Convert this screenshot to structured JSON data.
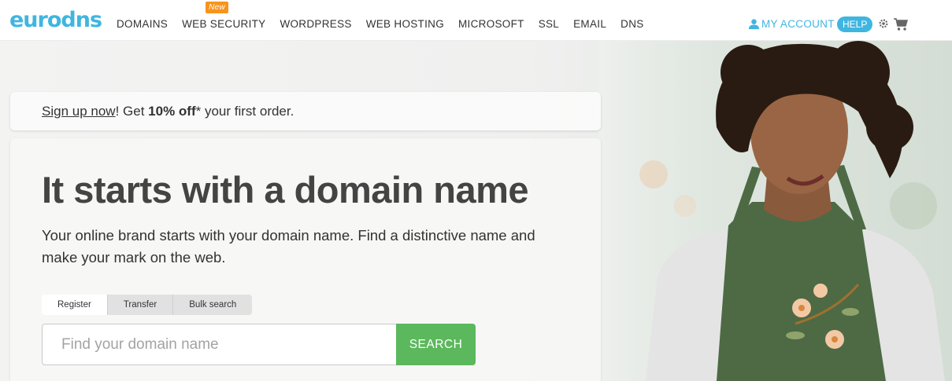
{
  "header": {
    "logo": "eurodns",
    "nav": [
      {
        "label": "DOMAINS"
      },
      {
        "label": "WEB SECURITY",
        "badge": "New"
      },
      {
        "label": "WORDPRESS"
      },
      {
        "label": "WEB HOSTING"
      },
      {
        "label": "MICROSOFT"
      },
      {
        "label": "SSL"
      },
      {
        "label": "EMAIL"
      },
      {
        "label": "DNS"
      }
    ],
    "account_label": "MY ACCOUNT",
    "help_label": "HELP",
    "icons": [
      "user-icon",
      "gear-icon",
      "cart-icon"
    ]
  },
  "promo": {
    "link": "Sign up now",
    "text_1": "! Get ",
    "bold": "10% off",
    "text_2": "* your first order."
  },
  "hero": {
    "title": "It starts with a domain name",
    "subtitle": "Your online brand starts with your domain name. Find a distinctive name and make your mark on the web.",
    "tabs": [
      {
        "label": "Register",
        "active": true
      },
      {
        "label": "Transfer",
        "active": false
      },
      {
        "label": "Bulk search",
        "active": false
      }
    ],
    "search_placeholder": "Find your domain name",
    "search_button": "SEARCH"
  },
  "colors": {
    "brand": "#3fb6e0",
    "badge": "#f7941d",
    "search_button": "#5cb85c"
  }
}
